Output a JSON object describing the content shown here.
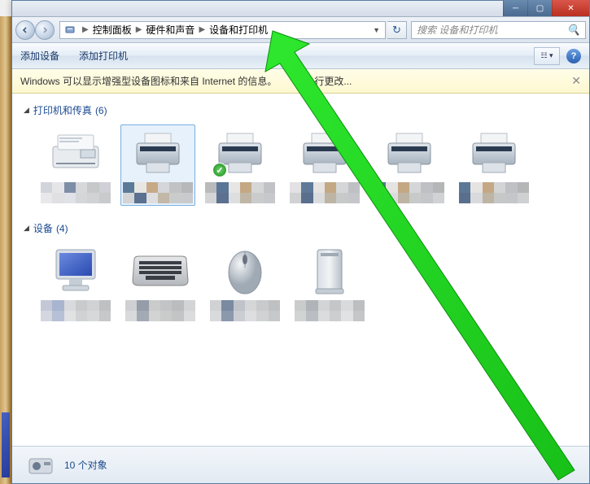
{
  "titlebar": {},
  "breadcrumb": {
    "items": [
      "控制面板",
      "硬件和声音",
      "设备和打印机"
    ]
  },
  "search": {
    "placeholder": "搜索 设备和打印机"
  },
  "toolbar": {
    "add_device": "添加设备",
    "add_printer": "添加打印机"
  },
  "infobar": {
    "text_a": "Windows 可以显示增强型设备图标和来自 Internet 的信息。",
    "text_b": "行更改..."
  },
  "groups": {
    "printers": {
      "label": "打印机和传真",
      "count": "(6)"
    },
    "devices": {
      "label": "设备",
      "count": "(4)"
    }
  },
  "status": {
    "count_text": "10 个对象"
  },
  "pixel_palettes": {
    "p0": [
      "#d2d4dc",
      "#e6e6e8",
      "#7e8ea6",
      "#d6d8da",
      "#c6c8ca",
      "#d0d0d6",
      "#e8e8ea",
      "#e0e0e2",
      "#e0e2e8",
      "#d4d6d8",
      "#d0d2d4",
      "#c8cacc"
    ],
    "p1": [
      "#5a7a98",
      "#e8e6e2",
      "#c6aa86",
      "#d4d6da",
      "#c0c2c4",
      "#b6b8ba",
      "#d2d4d6",
      "#5c7090",
      "#dedee0",
      "#c2b8a8",
      "#cacccc",
      "#c8cace"
    ],
    "p2": [
      "#b8babc",
      "#5a7696",
      "#e8e6e4",
      "#c4a884",
      "#d4d6d8",
      "#c0c2c6",
      "#d2d4d6",
      "#5c7090",
      "#dcdee0",
      "#c0b6a6",
      "#cacccc",
      "#c6c8cc"
    ],
    "p3": [
      "#e2e2e4",
      "#5e7a98",
      "#e6e4e2",
      "#c4a884",
      "#d4d6d8",
      "#bec0c4",
      "#d0d2d4",
      "#5a6e8e",
      "#dadcde",
      "#beb4a4",
      "#c8caca",
      "#c4c6ca"
    ],
    "p4": [
      "#5c7896",
      "#e6e4e2",
      "#c4a884",
      "#d4d6d8",
      "#bec0c4",
      "#b4b6b8",
      "#5a6e8e",
      "#dadcde",
      "#beb4a4",
      "#c8caca",
      "#c4c6ca",
      "#d0d2d4"
    ],
    "p5": [
      "#5c7896",
      "#e6e4e2",
      "#c4a884",
      "#d2d4d6",
      "#bec0c4",
      "#b4b6b8",
      "#5a6e8e",
      "#d8dadc",
      "#beb4a4",
      "#c6c8c8",
      "#c4c6ca",
      "#ced0d2"
    ],
    "d0": [
      "#c4c8d6",
      "#a8b4d0",
      "#d8dade",
      "#c8cacc",
      "#d0d2d4",
      "#bec0c2",
      "#d4d6e0",
      "#b6c0d6",
      "#e0e2e4",
      "#d0d2d4",
      "#d6d8da",
      "#c6c8ca"
    ],
    "d1": [
      "#ced0d2",
      "#969ca8",
      "#cacccc",
      "#c2c4c6",
      "#babcbe",
      "#d2d4d6",
      "#d8dadc",
      "#a4aab4",
      "#d2d4d4",
      "#cacccc",
      "#c2c4c6",
      "#dadcde"
    ],
    "d2": [
      "#d0d2d4",
      "#7a8aa0",
      "#c0c4ca",
      "#d4d6d8",
      "#c8cacc",
      "#bec0c2",
      "#d8dadc",
      "#8c98ac",
      "#cacdd2",
      "#dcdee0",
      "#d0d2d4",
      "#c6c8ca"
    ],
    "d3": [
      "#cacccc",
      "#b0b4b8",
      "#d2d4d6",
      "#c4c6c8",
      "#d8dadc",
      "#bcbec0",
      "#d2d4d4",
      "#babec2",
      "#dadcde",
      "#cccecf",
      "#e0e2e4",
      "#c4c6c8"
    ]
  }
}
